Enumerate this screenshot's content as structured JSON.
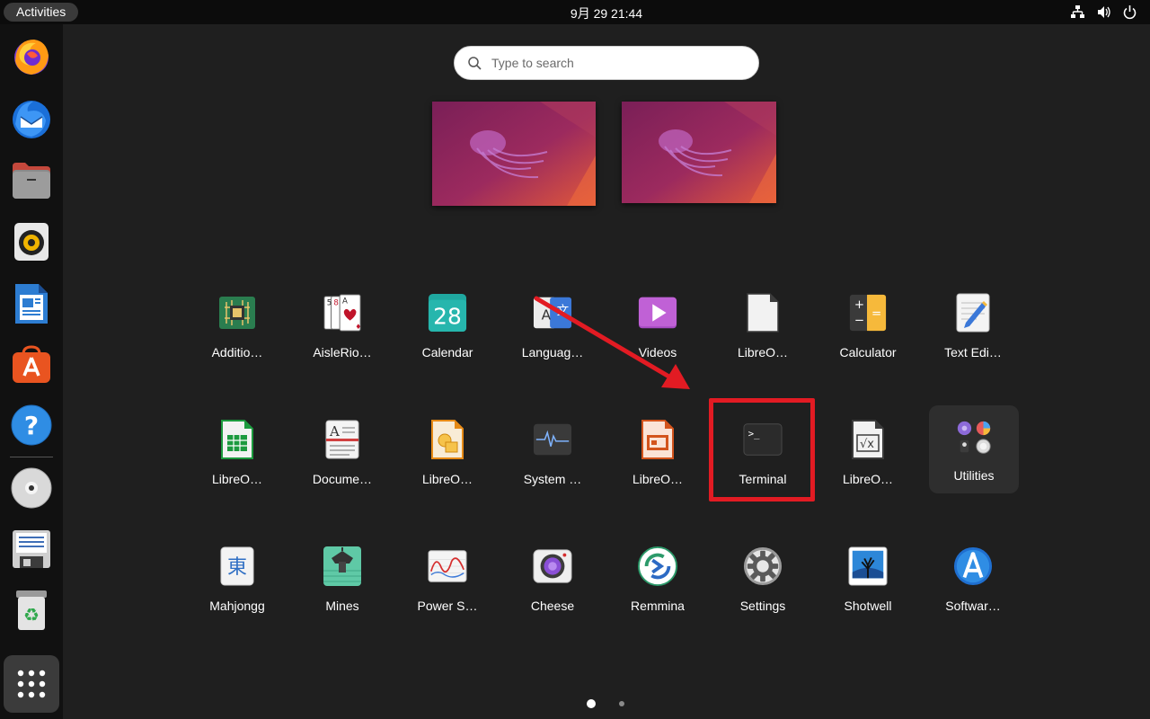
{
  "topbar": {
    "activities_label": "Activities",
    "clock": "9月 29  21:44",
    "tray_icons": [
      "network-icon",
      "volume-icon",
      "power-icon"
    ]
  },
  "dock": {
    "items": [
      "Firefox",
      "Thunderbird",
      "Files",
      "Rhythmbox",
      "LibreOffice Writer",
      "Ubuntu Software",
      "Help",
      "DVD",
      "Save",
      "Trash"
    ],
    "show_apps_icon": "app-grid-icon"
  },
  "search": {
    "placeholder": "Type to search"
  },
  "apps": [
    {
      "label": "Additio…",
      "icon": "chip-icon"
    },
    {
      "label": "AisleRio…",
      "icon": "cards-icon"
    },
    {
      "label": "Calendar",
      "icon": "calendar-icon",
      "day": "28"
    },
    {
      "label": "Languag…",
      "icon": "language-icon"
    },
    {
      "label": "Videos",
      "icon": "videos-icon"
    },
    {
      "label": "LibreO…",
      "icon": "libreoffice-icon"
    },
    {
      "label": "Calculator",
      "icon": "calculator-icon"
    },
    {
      "label": "Text Edi…",
      "icon": "text-editor-icon"
    },
    {
      "label": "LibreO…",
      "icon": "calc-sheet-icon"
    },
    {
      "label": "Docume…",
      "icon": "document-viewer-icon"
    },
    {
      "label": "LibreO…",
      "icon": "draw-icon"
    },
    {
      "label": "System …",
      "icon": "system-monitor-icon"
    },
    {
      "label": "LibreO…",
      "icon": "impress-icon"
    },
    {
      "label": "Terminal",
      "icon": "terminal-icon",
      "prompt": ">_"
    },
    {
      "label": "LibreO…",
      "icon": "math-icon"
    },
    {
      "label": "Utilities",
      "icon": "utilities-folder-icon"
    },
    {
      "label": "Mahjongg",
      "icon": "mahjongg-icon",
      "glyph": "東"
    },
    {
      "label": "Mines",
      "icon": "mines-icon"
    },
    {
      "label": "Power S…",
      "icon": "power-stats-icon"
    },
    {
      "label": "Cheese",
      "icon": "cheese-icon"
    },
    {
      "label": "Remmina",
      "icon": "remmina-icon"
    },
    {
      "label": "Settings",
      "icon": "settings-icon"
    },
    {
      "label": "Shotwell",
      "icon": "shotwell-icon"
    },
    {
      "label": "Softwar…",
      "icon": "software-icon"
    }
  ],
  "annotation": {
    "highlight_color": "#e21b23"
  },
  "pages": {
    "count": 2,
    "current": 1
  }
}
